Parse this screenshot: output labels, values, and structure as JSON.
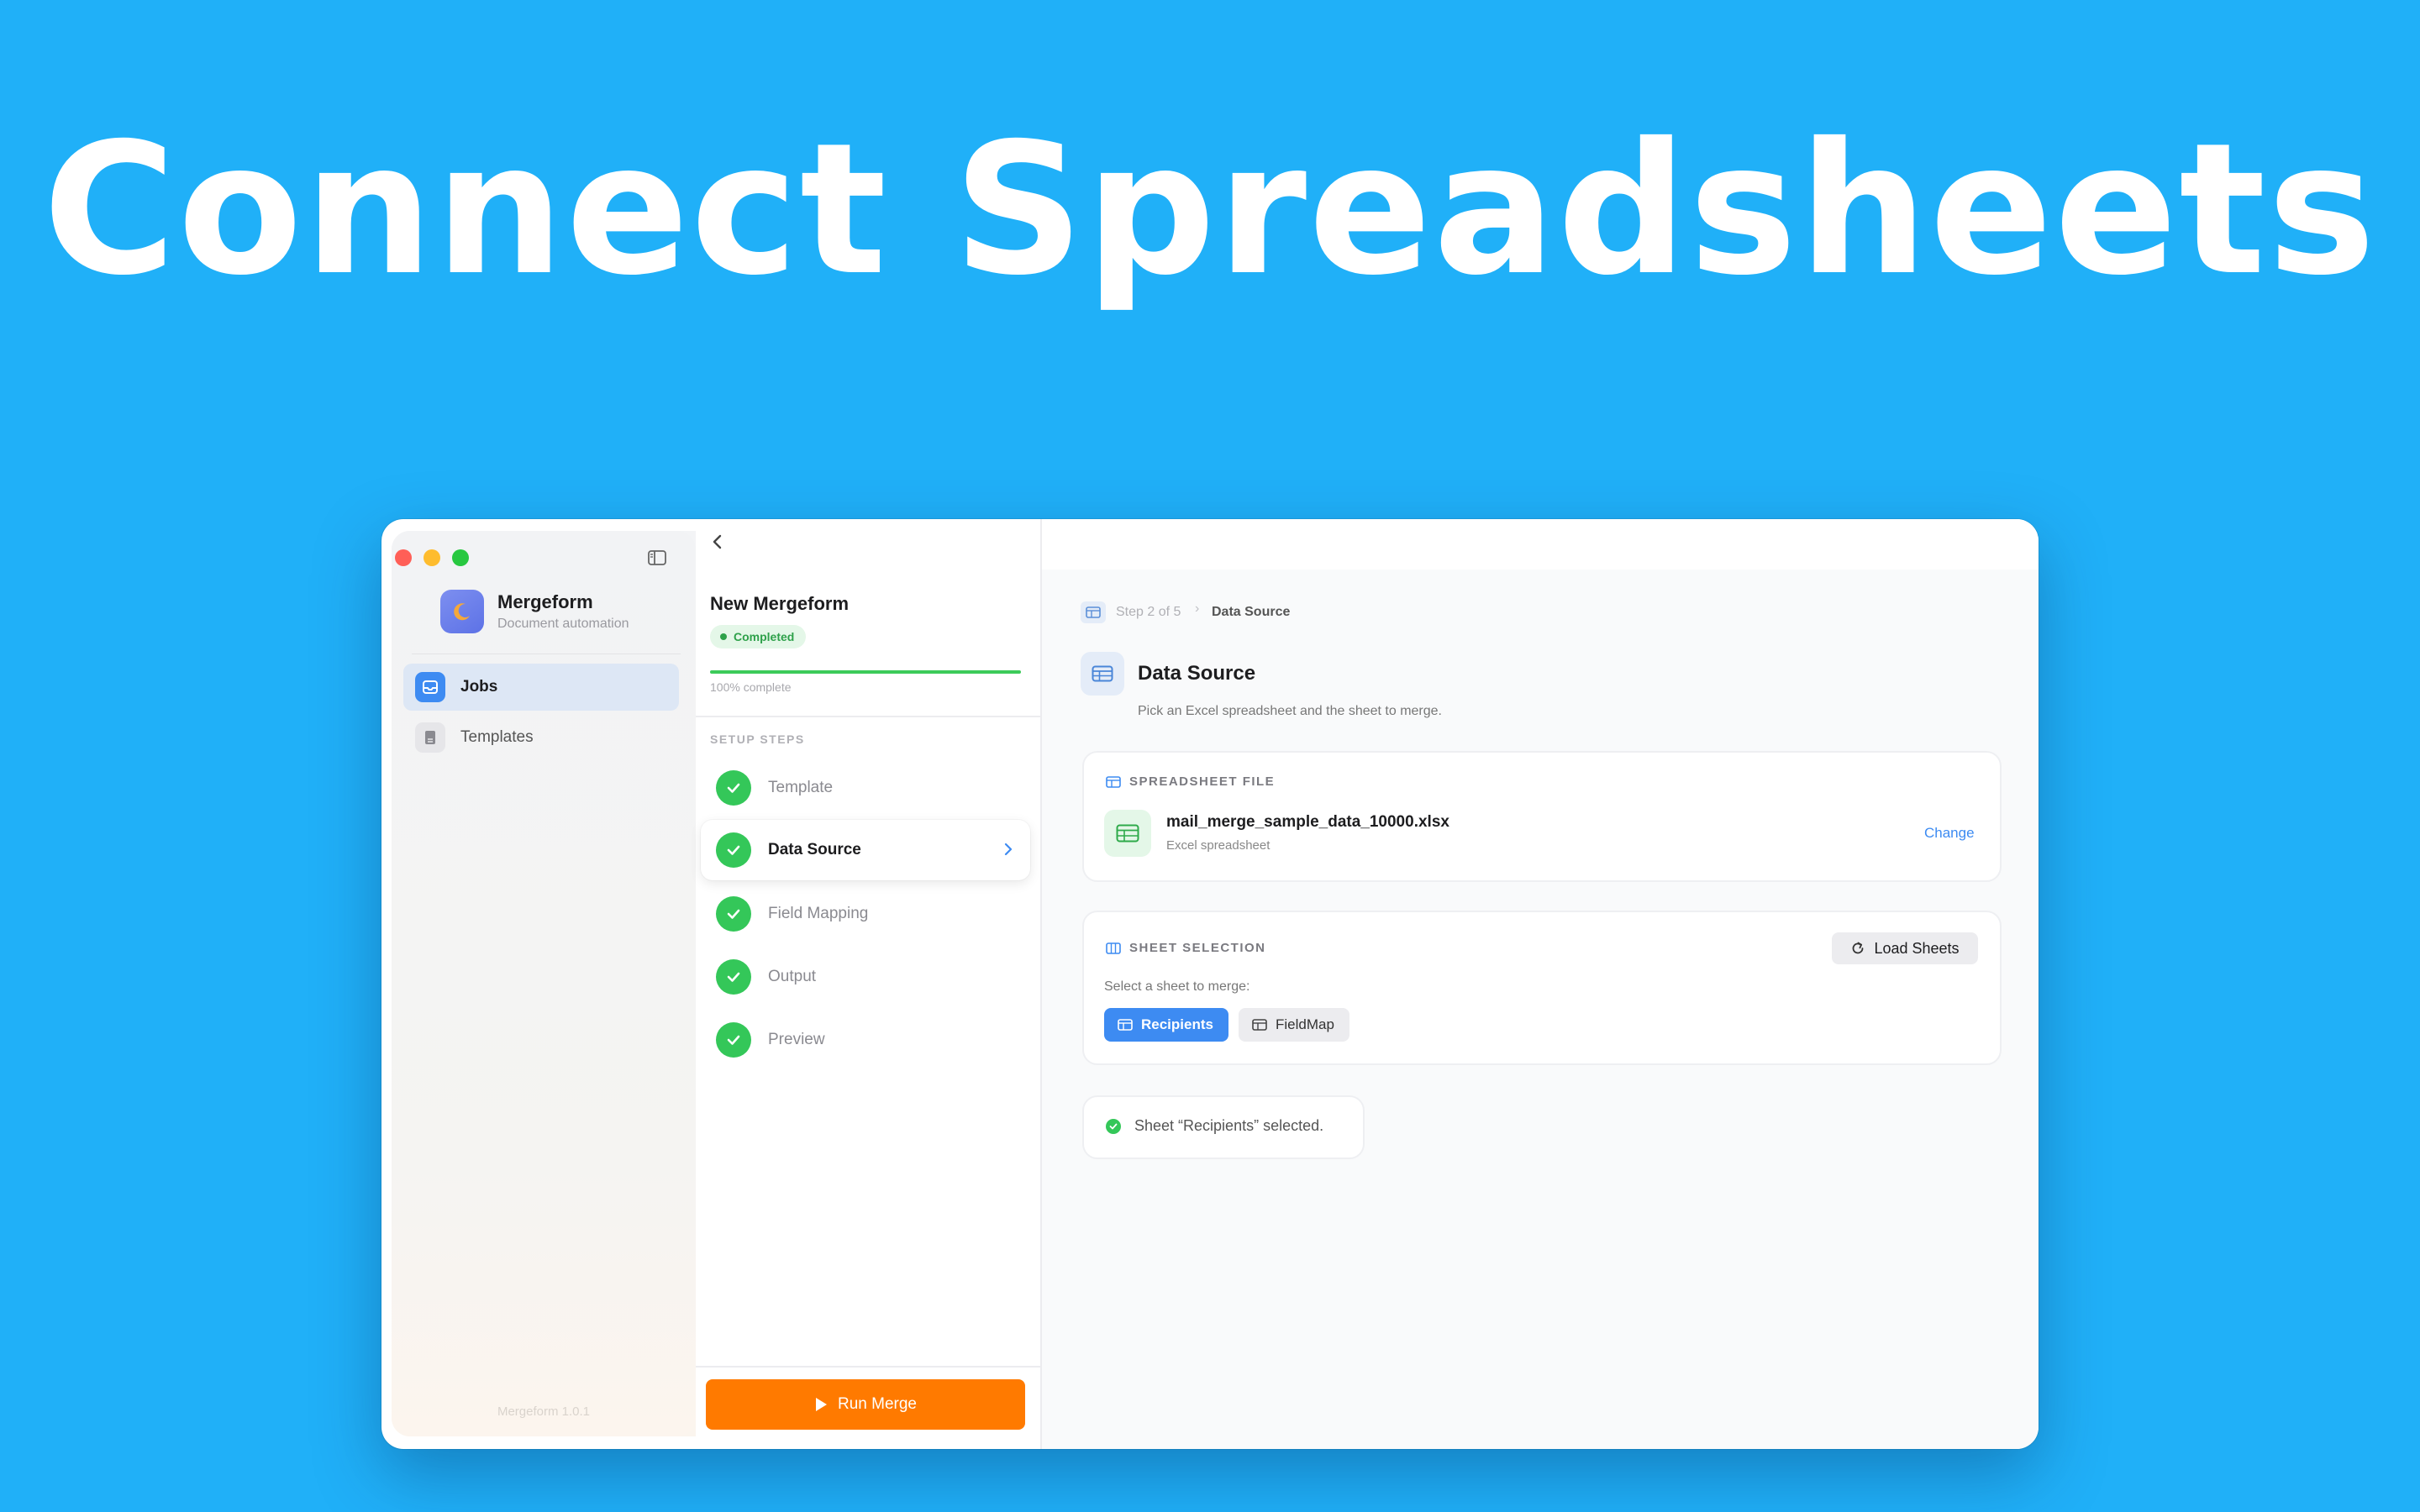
{
  "headline": "Connect Spreadsheets",
  "colors": {
    "background": "#20B0F8",
    "accent": "#3D8BF2",
    "success": "#34C759",
    "run_button": "#FF7A00"
  },
  "sidebar": {
    "app_name": "Mergeform",
    "app_subtitle": "Document automation",
    "items": [
      {
        "label": "Jobs",
        "icon": "tray-icon",
        "active": true
      },
      {
        "label": "Templates",
        "icon": "document-icon",
        "active": false
      }
    ],
    "version": "Mergeform 1.0.1"
  },
  "job": {
    "title": "New Mergeform",
    "status": "Completed",
    "progress_fraction": 1.0,
    "progress_label": "100% complete",
    "steps_header": "SETUP STEPS",
    "steps": [
      {
        "label": "Template",
        "done": true,
        "active": false
      },
      {
        "label": "Data Source",
        "done": true,
        "active": true
      },
      {
        "label": "Field Mapping",
        "done": true,
        "active": false
      },
      {
        "label": "Output",
        "done": true,
        "active": false
      },
      {
        "label": "Preview",
        "done": true,
        "active": false
      }
    ],
    "run_label": "Run Merge"
  },
  "detail": {
    "breadcrumb_step": "Step 2 of 5",
    "breadcrumb_current": "Data Source",
    "title": "Data Source",
    "subtitle": "Pick an Excel spreadsheet and the sheet to merge.",
    "file_section": {
      "header": "SPREADSHEET FILE",
      "file_name": "mail_merge_sample_data_10000.xlsx",
      "file_type": "Excel spreadsheet",
      "change_label": "Change"
    },
    "sheet_section": {
      "header": "SHEET SELECTION",
      "load_label": "Load Sheets",
      "select_label": "Select a sheet to merge:",
      "sheets": [
        {
          "label": "Recipients",
          "selected": true
        },
        {
          "label": "FieldMap",
          "selected": false
        }
      ]
    },
    "status_message": "Sheet “Recipients” selected."
  }
}
